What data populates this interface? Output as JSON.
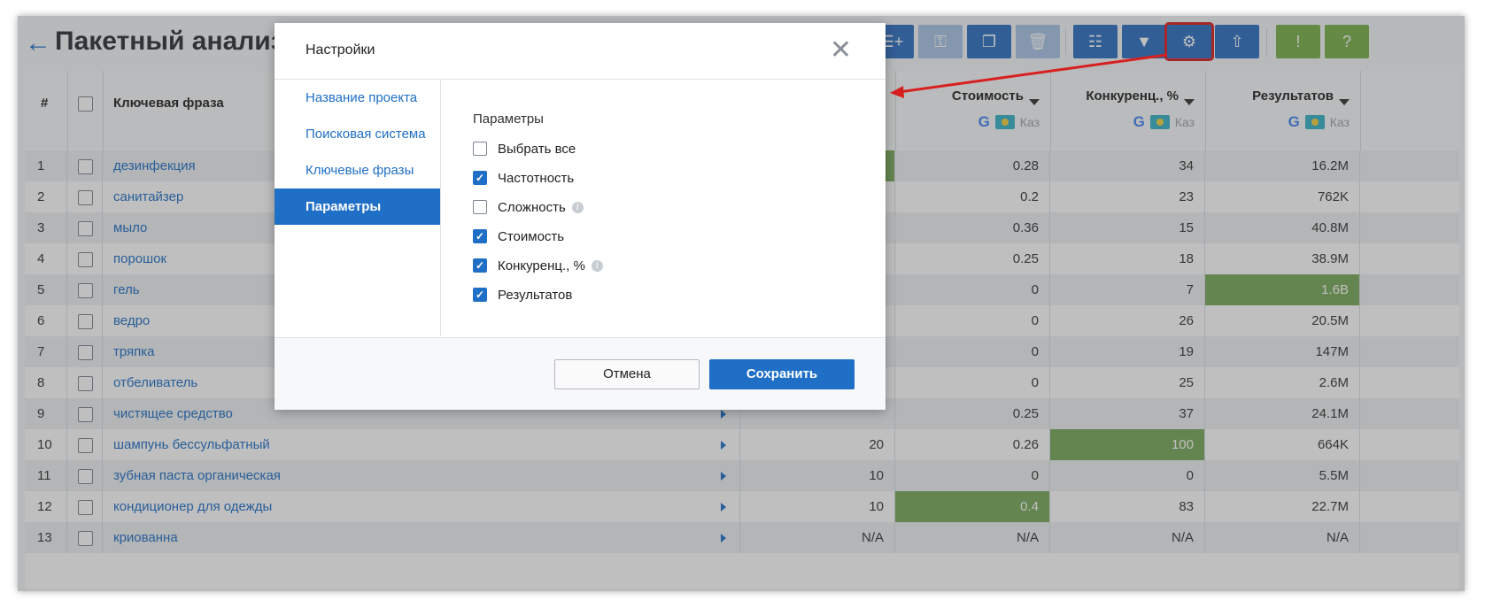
{
  "header": {
    "back_icon": "arrow-left-icon",
    "title": "Пакетный анализ"
  },
  "toolbar": {
    "buttons": [
      {
        "name": "add-list",
        "icon": "add-list-icon",
        "style": "blue"
      },
      {
        "name": "key",
        "icon": "key-icon",
        "style": "blue-pale"
      },
      {
        "name": "copy",
        "icon": "copy-icon",
        "style": "blue"
      },
      {
        "name": "delete",
        "icon": "trash-icon",
        "style": "blue-pale"
      },
      {
        "name": "columns",
        "icon": "list-icon",
        "style": "blue"
      },
      {
        "name": "filter",
        "icon": "filter-icon",
        "style": "blue"
      },
      {
        "name": "settings",
        "icon": "gear-icon",
        "style": "blue",
        "highlighted": true
      },
      {
        "name": "export",
        "icon": "upload-icon",
        "style": "blue"
      },
      {
        "name": "feedback",
        "icon": "exclamation-icon",
        "style": "green"
      },
      {
        "name": "help",
        "icon": "question-icon",
        "style": "green"
      }
    ]
  },
  "table": {
    "headers": {
      "num": "#",
      "keyword": "Ключевая фраза",
      "cost": "Стоимость",
      "competition": "Конкуренц., %",
      "results": "Результатов",
      "engine_label": "Каз"
    },
    "rows": [
      {
        "n": "1",
        "kw": "дезинфекция",
        "freq": "",
        "cost": "0.28",
        "comp": "34",
        "res": "16.2M"
      },
      {
        "n": "2",
        "kw": "санитайзер",
        "freq": "",
        "cost": "0.2",
        "comp": "23",
        "res": "762K"
      },
      {
        "n": "3",
        "kw": "мыло",
        "freq": "",
        "cost": "0.36",
        "comp": "15",
        "res": "40.8M"
      },
      {
        "n": "4",
        "kw": "порошок",
        "freq": "",
        "cost": "0.25",
        "comp": "18",
        "res": "38.9M"
      },
      {
        "n": "5",
        "kw": "гель",
        "freq": "",
        "cost": "0",
        "comp": "7",
        "res": "1.6B"
      },
      {
        "n": "6",
        "kw": "ведро",
        "freq": "",
        "cost": "0",
        "comp": "26",
        "res": "20.5M"
      },
      {
        "n": "7",
        "kw": "тряпка",
        "freq": "",
        "cost": "0",
        "comp": "19",
        "res": "147M"
      },
      {
        "n": "8",
        "kw": "отбеливатель",
        "freq": "",
        "cost": "0",
        "comp": "25",
        "res": "2.6M"
      },
      {
        "n": "9",
        "kw": "чистящее средство",
        "freq": "",
        "cost": "0.25",
        "comp": "37",
        "res": "24.1M"
      },
      {
        "n": "10",
        "kw": "шампунь бессульфатный",
        "freq": "20",
        "cost": "0.26",
        "comp": "100",
        "res": "664K"
      },
      {
        "n": "11",
        "kw": "зубная паста органическая",
        "freq": "10",
        "cost": "0",
        "comp": "0",
        "res": "5.5M"
      },
      {
        "n": "12",
        "kw": "кондиционер для одежды",
        "freq": "10",
        "cost": "0.4",
        "comp": "83",
        "res": "22.7M"
      },
      {
        "n": "13",
        "kw": "криованна",
        "freq": "N/A",
        "cost": "N/A",
        "comp": "N/A",
        "res": "N/A"
      }
    ]
  },
  "modal": {
    "title": "Настройки",
    "close_icon": "close-icon",
    "nav": [
      {
        "label": "Название проекта",
        "active": false
      },
      {
        "label": "Поисковая система",
        "active": false
      },
      {
        "label": "Ключевые фразы",
        "active": false
      },
      {
        "label": "Параметры",
        "active": true
      }
    ],
    "params_title": "Параметры",
    "options": [
      {
        "label": "Выбрать все",
        "checked": false,
        "info": false
      },
      {
        "label": "Частотность",
        "checked": true,
        "info": false
      },
      {
        "label": "Сложность",
        "checked": false,
        "info": true
      },
      {
        "label": "Стоимость",
        "checked": true,
        "info": false
      },
      {
        "label": "Конкуренц., %",
        "checked": true,
        "info": true
      },
      {
        "label": "Результатов",
        "checked": true,
        "info": false
      }
    ],
    "cancel_label": "Отмена",
    "save_label": "Сохранить"
  },
  "colors": {
    "accent": "#1f6fc6",
    "highlight_green": "#78a95a",
    "annotation_red": "#d81f1f"
  }
}
